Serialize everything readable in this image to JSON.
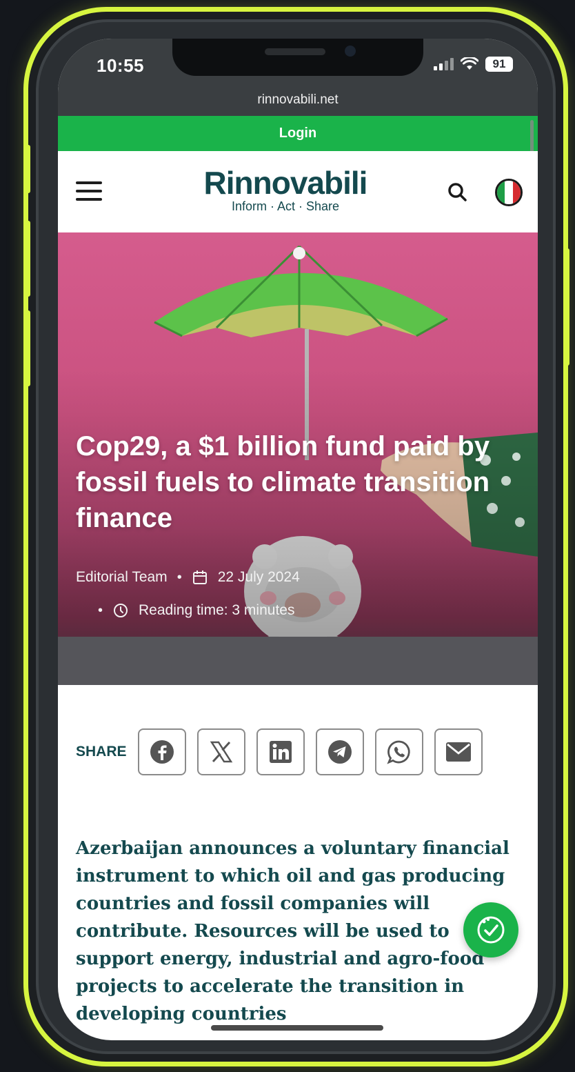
{
  "status_bar": {
    "time": "10:55",
    "battery": "91"
  },
  "browser": {
    "url": "rinnovabili.net"
  },
  "top_bar": {
    "login_label": "Login"
  },
  "header": {
    "logo_text": "Rinnovabili",
    "tagline": "Inform · Act · Share",
    "menu_icon": "hamburger-icon",
    "search_icon": "search-icon",
    "language_icon": "italy-flag-icon"
  },
  "article": {
    "title": "Cop29, a $1 billion fund paid by fossil fuels to climate transition finance",
    "author": "Editorial Team",
    "date": "22 July 2024",
    "reading_time": "Reading time: 3 minutes",
    "summary": "Azerbaijan announces a voluntary financial instrument to which oil and gas producing countries and fossil companies will contribute. Resources will be used to support energy, industrial and agro-food projects to accelerate the transition in developing countries"
  },
  "share": {
    "label": "SHARE",
    "buttons": [
      "facebook-icon",
      "x-icon",
      "linkedin-icon",
      "telegram-icon",
      "whatsapp-icon",
      "email-icon"
    ]
  },
  "colors": {
    "brand_green": "#1ab34a",
    "brand_teal": "#14494e",
    "frame_highlight": "#d7f540",
    "hero_pink": "#d55c8d"
  }
}
